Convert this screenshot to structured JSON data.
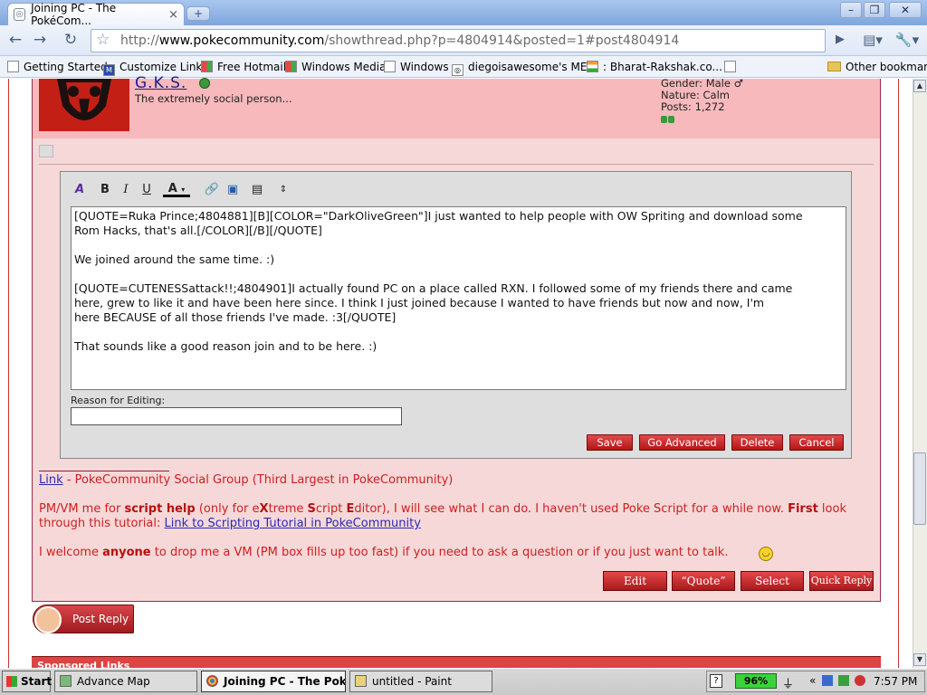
{
  "browser": {
    "tab_title": "Joining PC - The PokéCom...",
    "url_prefix": "http://",
    "url_host": "www.pokecommunity.com",
    "url_path": "/showthread.php?p=4804914&posted=1#post4804914"
  },
  "bookmarks": [
    "Getting Started",
    "Customize Links",
    "Free Hotmail",
    "Windows Media",
    "Windows",
    "diegoisawesome's ME...",
    ": Bharat-Rakshak.co...",
    "Other bookmarks"
  ],
  "post": {
    "username": "G.K.S.",
    "user_title": "The extremely social person...",
    "gender": "Gender: Male ♂",
    "nature": "Nature: Calm",
    "posts": "Posts: 1,272"
  },
  "editor": {
    "toolbar": [
      "B",
      "I",
      "U",
      "A"
    ],
    "text": "[QUOTE=Ruka Prince;4804881][B][COLOR=\"DarkOliveGreen\"]I just wanted to help people with OW Spriting and download some\nRom Hacks, that's all.[/COLOR][/B][/QUOTE]\n\nWe joined around the same time. :)\n\n[QUOTE=CUTENESSattack!!;4804901]I actually found PC on a place called RXN. I followed some of my friends there and came\nhere, grew to like it and have been here since. I think I just joined because I wanted to have friends but now and now, I'm\nhere BECAUSE of all those friends I've made. :3[/QUOTE]\n\nThat sounds like a good reason join and to be here. :)",
    "reason_label": "Reason for Editing:",
    "reason_value": "",
    "buttons": [
      "Save",
      "Go Advanced",
      "Delete",
      "Cancel"
    ]
  },
  "signature": {
    "link1": "Link",
    "line1_rest": " - PokeCommunity Social Group (Third Largest in PokeCommunity)",
    "line2_a": "PM/VM me for ",
    "line2_b": "script help",
    "line2_c": " (only for e",
    "line2_d": "X",
    "line2_e": "treme ",
    "line2_f": "S",
    "line2_g": "cript ",
    "line2_h": "E",
    "line2_i": "ditor), I will see what I can do. I haven't used Poke Script for a while now. ",
    "line2_j": "First",
    "line2_k": " look",
    "line3_a": "through this tutorial: ",
    "line3_link": "Link to Scripting Tutorial in PokeCommunity",
    "line4_a": "I welcome ",
    "line4_b": "anyone",
    "line4_c": " to drop me a VM (PM box fills up too fast) if you need to ask a question or if you just want to talk."
  },
  "post_buttons": [
    "Edit",
    "“Quote”",
    "Select",
    "Quick Reply"
  ],
  "post_reply": "Post Reply",
  "sponsored": "Sponsored Links",
  "taskbar": {
    "start": "Start",
    "tasks": [
      "Advance Map",
      "Joining PC - The Poké...",
      "untitled - Paint"
    ],
    "battery": "96%",
    "clock": "7:57 PM"
  }
}
